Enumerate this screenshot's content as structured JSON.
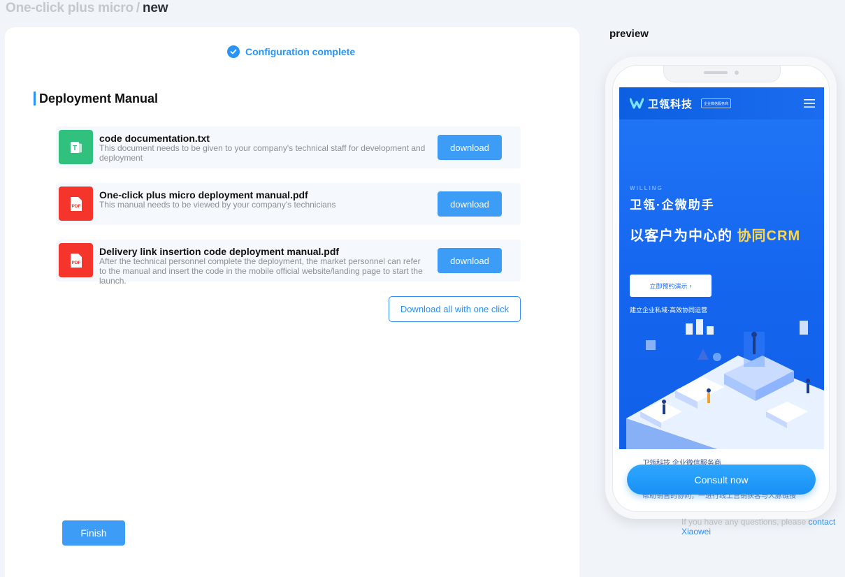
{
  "breadcrumb": {
    "parent": "One-click plus micro",
    "separator": "/",
    "current": "new"
  },
  "status": {
    "text": "Configuration complete",
    "icon": "check-circle-icon"
  },
  "section": {
    "title": "Deployment Manual"
  },
  "files": [
    {
      "name": "code documentation.txt",
      "description": "This document needs to be given to your company's technical staff for development and deployment",
      "icon": "T",
      "icon_name": "txt-file-icon",
      "color": "#2fc17d",
      "button": "download"
    },
    {
      "name": "One-click plus micro deployment manual.pdf",
      "description": "This manual needs to be viewed by your company's technicians",
      "icon": "PDF",
      "icon_name": "pdf-file-icon",
      "color": "#f5342b",
      "button": "download"
    },
    {
      "name": "Delivery link insertion code deployment manual.pdf",
      "description": "After the technical personnel complete the deployment, the market personnel can refer to the manual and insert the code in the mobile official website/landing page to start the launch.",
      "icon": "PDF",
      "icon_name": "pdf-file-icon",
      "color": "#f5342b",
      "button": "download"
    }
  ],
  "download_all": "Download all with one click",
  "finish": "Finish",
  "preview": {
    "label": "preview",
    "brand": "卫瓴科技",
    "badge": "企业微信服务商",
    "eyebrow": "WILLING",
    "sub_title": "卫瓴·企微助手",
    "headline_prefix": "以客户为中心的",
    "headline_highlight": "协同CRM",
    "demo_button": "立即预约演示",
    "tagline": "建立企业私域·高效协同运营",
    "below_line1": "卫瓴科技 企业微信服务商",
    "below_line2": "帮助销售的协同，一进行线上营销获客与人脉链接"
  },
  "consult_button": "Consult now",
  "help": {
    "text": "If you have any questions, please",
    "link": "contact Xiaowei"
  },
  "colors": {
    "accent": "#2994f5",
    "txt_icon": "#2fc17d",
    "pdf_icon": "#f5342b",
    "hero_blue": "#1464ee",
    "highlight": "#ffd84a"
  }
}
